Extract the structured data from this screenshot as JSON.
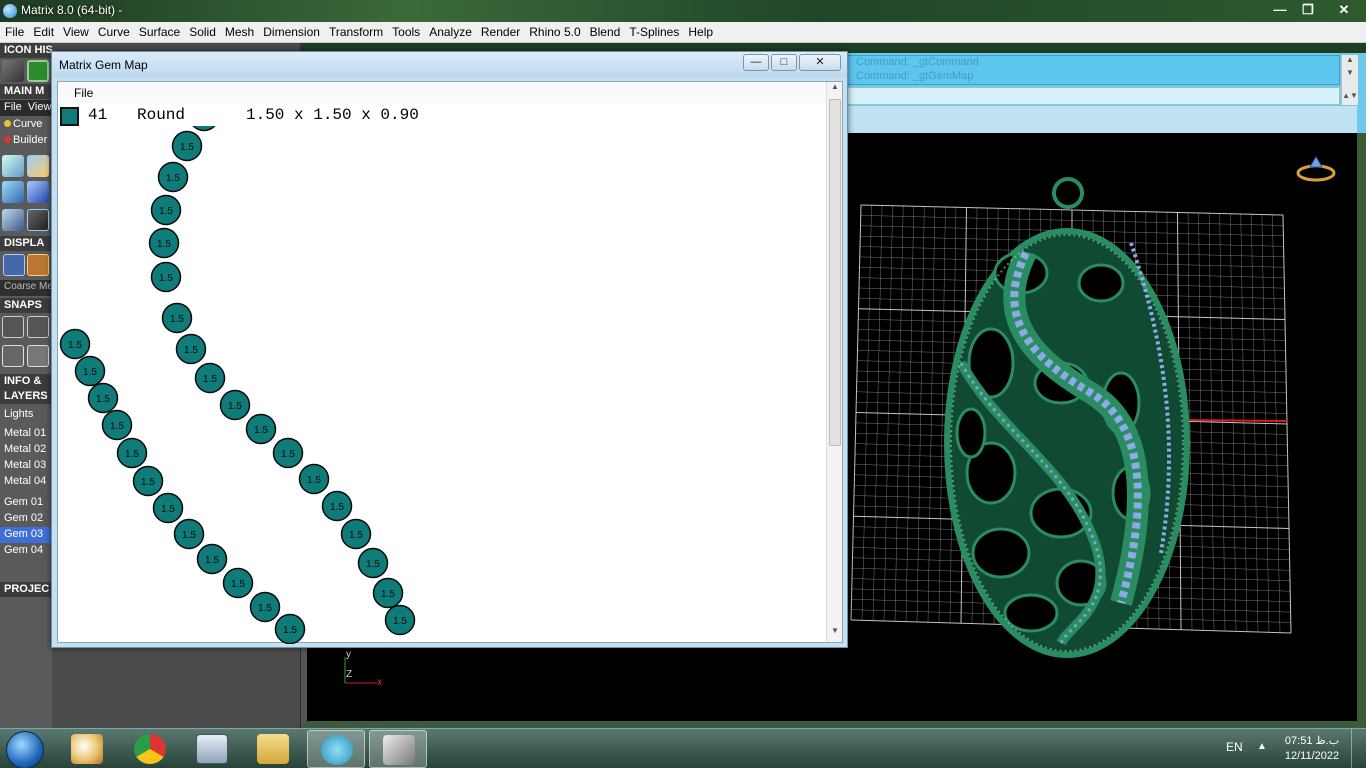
{
  "app": {
    "title": "Matrix 8.0 (64-bit) -"
  },
  "window_controls": {
    "minimize": "—",
    "restore": "❐",
    "close": "✕"
  },
  "menubar": [
    "File",
    "Edit",
    "View",
    "Curve",
    "Surface",
    "Solid",
    "Mesh",
    "Dimension",
    "Transform",
    "Tools",
    "Analyze",
    "Render",
    "Rhino 5.0",
    "Blend",
    "T-Splines",
    "Help"
  ],
  "left_panel": {
    "icon_history": "ICON HISTORY",
    "main_menu": "MAIN M",
    "file": "File",
    "view": "View",
    "curve": "Curve",
    "builder": "Builder",
    "display": "DISPLA",
    "coarse": "Coarse Me",
    "snaps": "SNAPS",
    "info": "INFO &",
    "layers": "LAYERS",
    "lights": "Lights",
    "layer_items": [
      "Metal 01",
      "Metal 02",
      "Metal 03",
      "Metal 04",
      "Gem 01",
      "Gem 02",
      "Gem 03",
      "Gem 04"
    ],
    "selected_layer": "Gem 03",
    "project": "PROJEC"
  },
  "command": {
    "line1": "Command: _gtCommand",
    "line2": "Command: _gtGemMap"
  },
  "gem_map": {
    "title": "Matrix Gem Map",
    "menu_file": "File",
    "row": {
      "count": "41",
      "shape": "Round",
      "dims": "1.50 x 1.50 x 0.90",
      "color": "#0f7c79"
    },
    "gem_label": "1.5"
  },
  "viewport": {
    "axis_y": "y",
    "axis_z": "Z",
    "axis_x": "x",
    "model_color": "#2a8c61",
    "accent_gem_color": "#8ea9e8",
    "grid_color": "#d9d9d9"
  },
  "taskbar": {
    "apps": [
      "paint-icon",
      "chrome-icon",
      "calculator-icon",
      "explorer-icon",
      "matrix-v8-icon",
      "rhino-icon"
    ],
    "active_apps": [
      "matrix-v8-icon",
      "rhino-icon"
    ],
    "lang": "EN",
    "time": "07:51 ب.ظ",
    "date": "12/11/2022"
  }
}
